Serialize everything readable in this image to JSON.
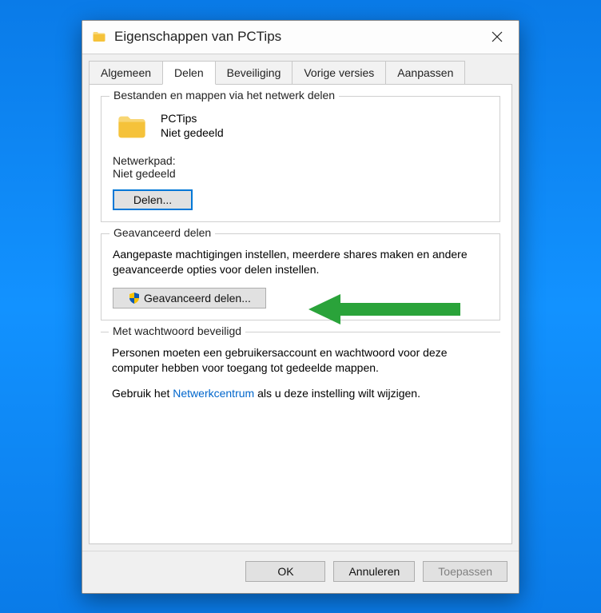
{
  "window": {
    "title": "Eigenschappen van PCTips"
  },
  "tabs": {
    "items": [
      "Algemeen",
      "Delen",
      "Beveiliging",
      "Vorige versies",
      "Aanpassen"
    ],
    "active_index": 1
  },
  "share_group": {
    "title": "Bestanden en mappen via het netwerk delen",
    "folder_name": "PCTips",
    "folder_status": "Niet gedeeld",
    "path_label": "Netwerkpad:",
    "path_value": "Niet gedeeld",
    "share_button": "Delen..."
  },
  "advanced_group": {
    "title": "Geavanceerd delen",
    "description": "Aangepaste machtigingen instellen, meerdere shares maken en andere geavanceerde opties voor delen instellen.",
    "button": "Geavanceerd delen..."
  },
  "password_group": {
    "title": "Met wachtwoord beveiligd",
    "line1": "Personen moeten een gebruikersaccount en wachtwoord voor deze computer hebben voor toegang tot gedeelde mappen.",
    "line2_prefix": "Gebruik het ",
    "line2_link": "Netwerkcentrum",
    "line2_suffix": " als u deze instelling wilt wijzigen."
  },
  "footer": {
    "ok": "OK",
    "cancel": "Annuleren",
    "apply": "Toepassen"
  }
}
